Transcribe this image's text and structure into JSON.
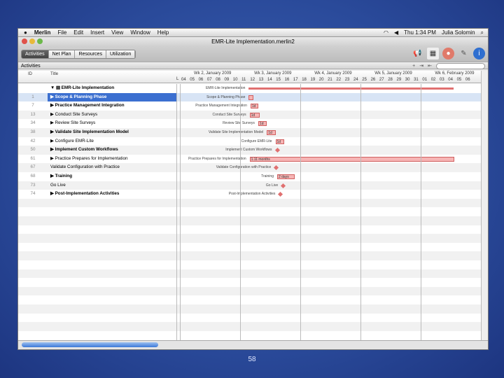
{
  "menubar": {
    "items": [
      "Merlin",
      "File",
      "Edit",
      "Insert",
      "View",
      "Window",
      "Help"
    ],
    "clock": "Thu 1:34 PM",
    "user": "Julia Solomin"
  },
  "window": {
    "title": "EMR-Lite Implementation.merlin2"
  },
  "toolbar": {
    "tabs": [
      "Activities",
      "Net Plan",
      "Resources",
      "Utilization"
    ]
  },
  "panel": {
    "title": "Activities"
  },
  "columns": {
    "id": "ID",
    "title": "Title",
    "l": "L"
  },
  "weeks": [
    "Wk 2, January 2009",
    "Wk 3, January 2009",
    "Wk 4, January 2009",
    "Wk 5, January 2009",
    "Wk 6, February 2009"
  ],
  "days": [
    "04",
    "05",
    "06",
    "07",
    "08",
    "09",
    "10",
    "11",
    "12",
    "13",
    "14",
    "15",
    "16",
    "17",
    "18",
    "19",
    "20",
    "21",
    "22",
    "23",
    "24",
    "25",
    "26",
    "27",
    "28",
    "29",
    "30",
    "31",
    "01",
    "02",
    "03",
    "04",
    "05",
    "06"
  ],
  "rows": [
    {
      "id": "",
      "title": "▼ ▤ EMR-Lite Implementation",
      "bold": true,
      "glabel": "EMR-Lite Implementation",
      "type": "summary",
      "start": 8,
      "dur": 23.8,
      "label": ""
    },
    {
      "id": "1",
      "title": "▶ Scope & Planning Phase",
      "bold": true,
      "glabel": "Scope & Planning Phase",
      "type": "bar",
      "start": 8,
      "dur": 0.5,
      "label": ""
    },
    {
      "id": "7",
      "title": "▶ Practice Management Integration",
      "bold": true,
      "glabel": "Practice Management Integration",
      "type": "bar",
      "start": 8.2,
      "dur": 0.9,
      "label": "1d"
    },
    {
      "id": "13",
      "title": "▶ Conduct Site Surveys",
      "bold": false,
      "glabel": "Conduct Site Surveys",
      "type": "bar",
      "start": 8.1,
      "dur": 1.2,
      "label": "1d"
    },
    {
      "id": "34",
      "title": "▶ Review Site Surveys",
      "bold": false,
      "glabel": "Review Site Surveys",
      "type": "bar",
      "start": 9.1,
      "dur": 1,
      "label": "1d"
    },
    {
      "id": "38",
      "title": "▶ Validate Site Implementation Model",
      "bold": true,
      "glabel": "Validate Site Implementation Model",
      "type": "bar",
      "start": 10.1,
      "dur": 1,
      "label": "1d"
    },
    {
      "id": "42",
      "title": "▶ Configure EMR-Lite",
      "bold": false,
      "glabel": "Configure EMR-Lite",
      "type": "bar",
      "start": 11.1,
      "dur": 1,
      "label": "1d"
    },
    {
      "id": "50",
      "title": "▶ Implement Custom Workflows",
      "bold": true,
      "glabel": "Implement Custom Workflows",
      "type": "milestone",
      "start": 11.1,
      "dur": 0,
      "label": ""
    },
    {
      "id": "61",
      "title": "▶ Practice Prepares for Implementation",
      "bold": false,
      "glabel": "Practice Prepares for Implementation",
      "type": "bar",
      "start": 8.1,
      "dur": 23.8,
      "label": "1.11 months"
    },
    {
      "id": "67",
      "title": "Validate Configuration with Practice",
      "bold": false,
      "glabel": "Validate Configuration with Practice",
      "type": "milestone",
      "start": 11,
      "dur": 0,
      "label": ""
    },
    {
      "id": "68",
      "title": "▶ Training",
      "bold": true,
      "glabel": "Training",
      "type": "bar",
      "start": 11.3,
      "dur": 2,
      "label": "2 days"
    },
    {
      "id": "73",
      "title": "Go Live",
      "bold": false,
      "glabel": "Go Live",
      "type": "milestone",
      "start": 11.8,
      "dur": 0,
      "label": ""
    },
    {
      "id": "74",
      "title": "▶ Post-Implementation Activities",
      "bold": true,
      "glabel": "Post-Implementation Activities",
      "type": "milestone",
      "start": 11.5,
      "dur": 0,
      "label": ""
    }
  ],
  "slide": {
    "page": "58"
  }
}
